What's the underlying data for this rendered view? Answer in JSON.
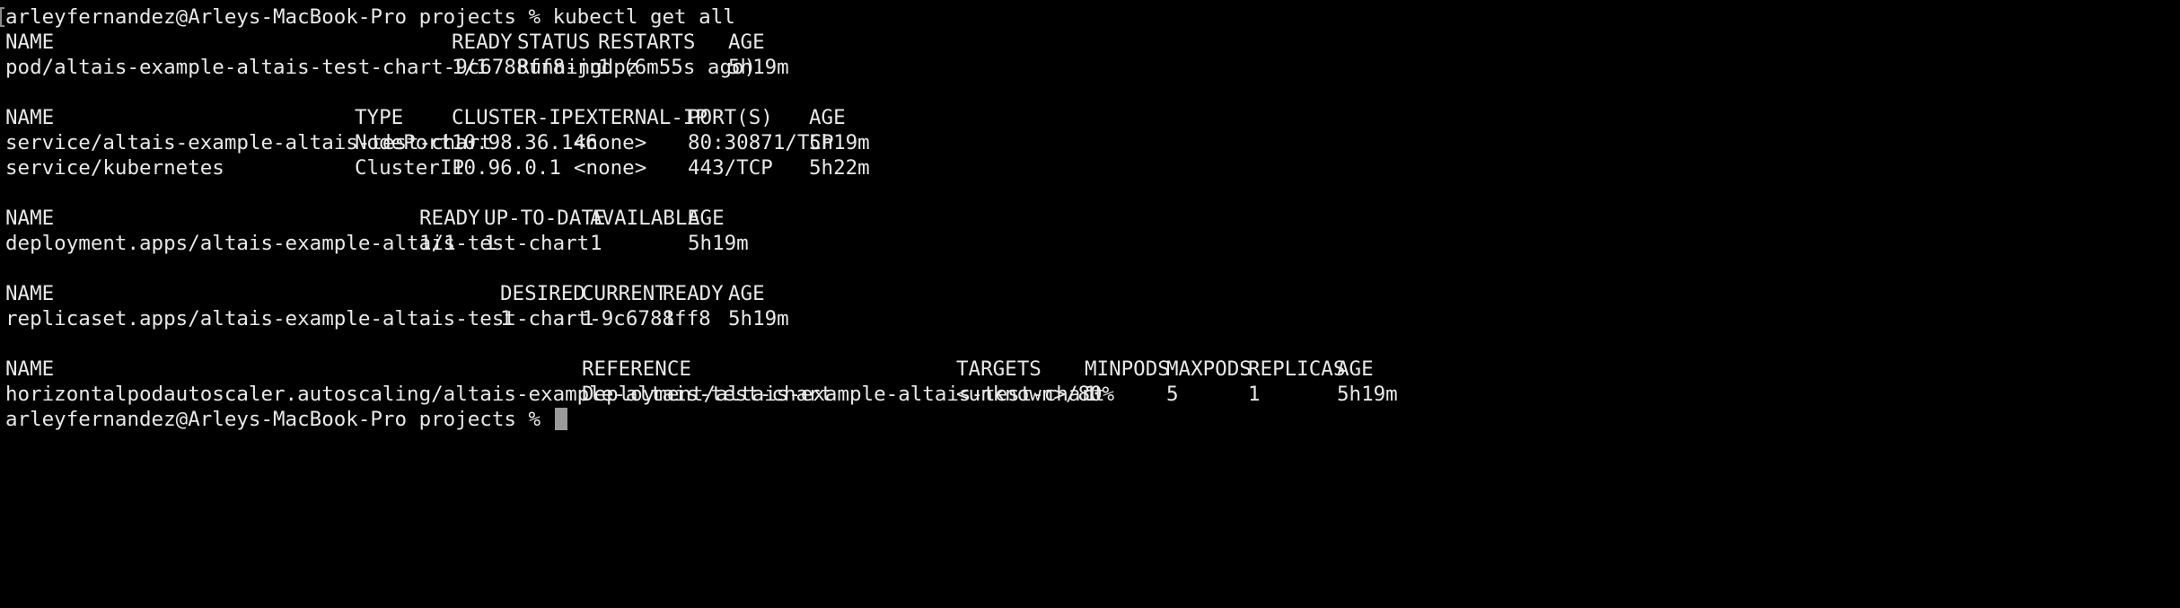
{
  "prompt": {
    "user_host": "arleyfernandez@Arleys-MacBook-Pro",
    "directory": "projects",
    "symbol": "%"
  },
  "command": "kubectl get all",
  "pods": {
    "headers": [
      "NAME",
      "READY",
      "STATUS",
      "RESTARTS",
      "AGE"
    ],
    "rows": [
      [
        "pod/altais-example-altais-test-chart-9c6788ff8-jndpz",
        "1/1",
        "Running",
        "1 (6m55s ago)",
        "5h19m"
      ]
    ]
  },
  "services": {
    "headers": [
      "NAME",
      "TYPE",
      "CLUSTER-IP",
      "EXTERNAL-IP",
      "PORT(S)",
      "AGE"
    ],
    "rows": [
      [
        "service/altais-example-altais-test-chart",
        "NodePort",
        "10.98.36.146",
        "<none>",
        "80:30871/TCP",
        "5h19m"
      ],
      [
        "service/kubernetes",
        "ClusterIP",
        "10.96.0.1",
        "<none>",
        "443/TCP",
        "5h22m"
      ]
    ]
  },
  "deployments": {
    "headers": [
      "NAME",
      "READY",
      "UP-TO-DATE",
      "AVAILABLE",
      "AGE"
    ],
    "rows": [
      [
        "deployment.apps/altais-example-altais-test-chart",
        "1/1",
        "1",
        "1",
        "5h19m"
      ]
    ]
  },
  "replicasets": {
    "headers": [
      "NAME",
      "DESIRED",
      "CURRENT",
      "READY",
      "AGE"
    ],
    "rows": [
      [
        "replicaset.apps/altais-example-altais-test-chart-9c6788ff8",
        "1",
        "1",
        "1",
        "5h19m"
      ]
    ]
  },
  "hpas": {
    "headers": [
      "NAME",
      "REFERENCE",
      "TARGETS",
      "MINPODS",
      "MAXPODS",
      "REPLICAS",
      "AGE"
    ],
    "rows": [
      [
        "horizontalpodautoscaler.autoscaling/altais-example-altais-test-chart",
        "Deployment/altais-example-altais-test-chart",
        "<unknown>/80%",
        "1",
        "5",
        "1",
        "5h19m"
      ]
    ]
  }
}
